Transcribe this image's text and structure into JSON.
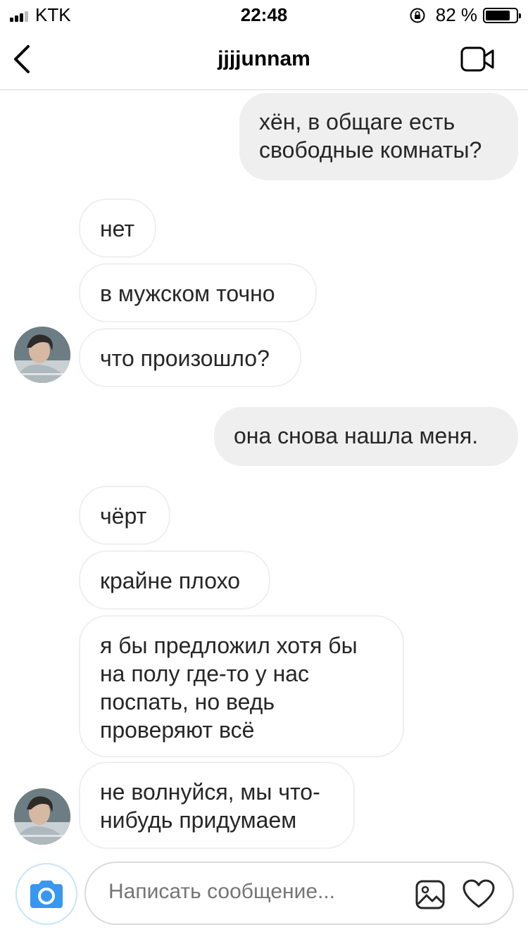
{
  "status_bar": {
    "carrier": "KTK",
    "time": "22:48",
    "battery_pct": "82 %",
    "battery_level": 0.82
  },
  "header": {
    "title": "jjjjunnam"
  },
  "messages": [
    {
      "direction": "outgoing",
      "text": "хён, в общаге есть\nсвободные комнаты?"
    },
    {
      "direction": "incoming",
      "text": "нет"
    },
    {
      "direction": "incoming",
      "text": "в мужском точно"
    },
    {
      "direction": "incoming",
      "text": "что произошло?"
    },
    {
      "direction": "outgoing",
      "text": "она снова нашла меня."
    },
    {
      "direction": "incoming",
      "text": "чёрт"
    },
    {
      "direction": "incoming",
      "text": "крайне плохо"
    },
    {
      "direction": "incoming",
      "text": "я бы предложил хотя бы\nна полу где-то у нас\nпоспать, но ведь\nпроверяют всё"
    },
    {
      "direction": "incoming",
      "text": "не волнуйся, мы что-\nнибудь придумаем"
    }
  ],
  "composer": {
    "placeholder": "Написать сообщение..."
  },
  "colors": {
    "accent": "#3897f0",
    "outgoing_bubble": "#efefef",
    "incoming_border": "#efefef"
  },
  "icons": {
    "back": "chevron-left-icon",
    "video": "video-camera-icon",
    "camera": "camera-icon",
    "gallery": "gallery-icon",
    "like": "heart-icon"
  }
}
